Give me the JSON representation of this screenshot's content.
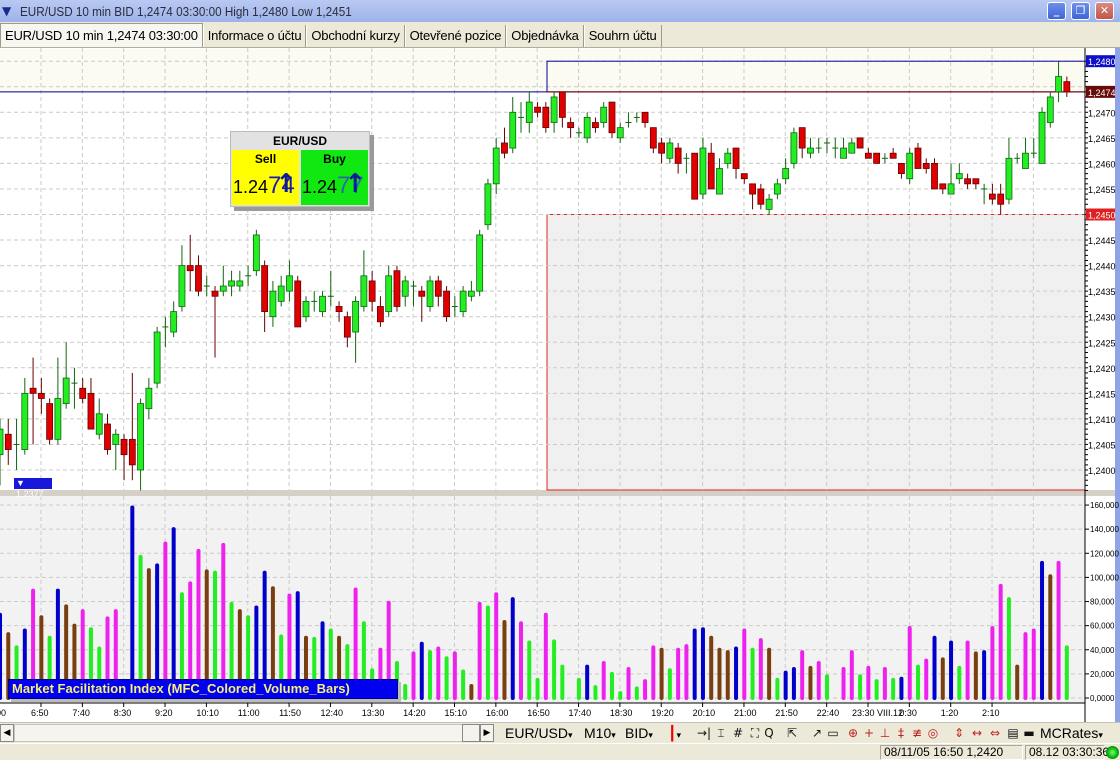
{
  "window": {
    "title": "EUR/USD 10 min BID 1,2474 03:30:00 High 1,2480 Low 1,2451",
    "minimize": "_",
    "restore": "❐",
    "close": "✕"
  },
  "tabs": [
    {
      "label": "EUR/USD 10 min 1,2474 03:30:00",
      "active": true
    },
    {
      "label": "Informace o účtu"
    },
    {
      "label": "Obchodní kurzy"
    },
    {
      "label": "Otevřené pozice"
    },
    {
      "label": "Objednávka"
    },
    {
      "label": "Souhrn účtu"
    }
  ],
  "widget": {
    "pair": "EUR/USD",
    "sell_label": "Sell",
    "buy_label": "Buy",
    "sell_prefix": "1.24",
    "sell_pips": "74",
    "buy_prefix": "1.24",
    "buy_pips": "77",
    "arrow": "↑"
  },
  "low_marker": "1,2377",
  "indicator_label": "Market Facilitation Index (MFC_Colored_Volume_Bars)",
  "colors": {
    "up": "#22ee22",
    "down": "#e00000",
    "g": "#22ee22",
    "m": "#ee22ee",
    "b": "#0000cc",
    "br": "#7a3f10",
    "high_line": "#0000a0",
    "last_line": "#7a0000",
    "low_line": "#e02020"
  },
  "price_axis": {
    "labels": [
      "1,2400",
      "1,2405",
      "1,2410",
      "1,2415",
      "1,2420",
      "1,2425",
      "1,2430",
      "1,2435",
      "1,2440",
      "1,2445",
      "1,2455",
      "1,2460",
      "1,2465",
      "1,2470"
    ],
    "markers": [
      {
        "label": "1,2480",
        "price": 1.248,
        "color": "#1010c8"
      },
      {
        "label": "1,2474",
        "price": 1.2474,
        "color": "#6b0a0a"
      },
      {
        "label": "1,2450",
        "price": 1.245,
        "color": "#e02020"
      }
    ]
  },
  "volume_axis": {
    "labels": [
      "0,0000",
      "20,000",
      "40,000",
      "60,000",
      "80,000",
      "100,000",
      "120,000",
      "140,000",
      "160,000"
    ]
  },
  "time_axis": {
    "labels": [
      "00",
      "6:50",
      "7:40",
      "8:30",
      "9:20",
      "10:10",
      "11:00",
      "11:50",
      "12:40",
      "13:30",
      "14:20",
      "15:10",
      "16:00",
      "16:50",
      "17:40",
      "18:30",
      "19:20",
      "20:10",
      "21:00",
      "21:50",
      "22:40",
      "23:30 VIII.12",
      "0:30",
      "1:20",
      "2:10"
    ]
  },
  "chart_data": {
    "type": "candlestick",
    "symbol": "EUR/USD",
    "timeframe": "10 min",
    "ylim": [
      1.2396,
      1.2482
    ],
    "ohlc": [
      [
        1.2403,
        1.241,
        1.2397,
        1.2408
      ],
      [
        1.2407,
        1.241,
        1.2401,
        1.2404
      ],
      [
        1.2405,
        1.241,
        1.24,
        1.2405
      ],
      [
        1.2404,
        1.2418,
        1.2403,
        1.2415
      ],
      [
        1.2416,
        1.2422,
        1.2405,
        1.2415
      ],
      [
        1.2415,
        1.2418,
        1.2411,
        1.2414
      ],
      [
        1.2413,
        1.2414,
        1.2405,
        1.2406
      ],
      [
        1.2406,
        1.2422,
        1.2405,
        1.2414
      ],
      [
        1.2413,
        1.2425,
        1.2412,
        1.2418
      ],
      [
        1.2417,
        1.242,
        1.2412,
        1.2417
      ],
      [
        1.2416,
        1.2418,
        1.2413,
        1.2414
      ],
      [
        1.2415,
        1.2418,
        1.2408,
        1.2408
      ],
      [
        1.2407,
        1.2414,
        1.2406,
        1.2411
      ],
      [
        1.2409,
        1.2411,
        1.2403,
        1.2404
      ],
      [
        1.2405,
        1.2408,
        1.24,
        1.2407
      ],
      [
        1.2406,
        1.2407,
        1.2398,
        1.2403
      ],
      [
        1.2406,
        1.2419,
        1.2398,
        1.2401
      ],
      [
        1.24,
        1.2414,
        1.2396,
        1.2413
      ],
      [
        1.2412,
        1.2418,
        1.241,
        1.2416
      ],
      [
        1.2417,
        1.2428,
        1.2416,
        1.2427
      ],
      [
        1.2428,
        1.243,
        1.2424,
        1.2428
      ],
      [
        1.2427,
        1.2433,
        1.2426,
        1.2431
      ],
      [
        1.2432,
        1.2444,
        1.2431,
        1.244
      ],
      [
        1.244,
        1.2446,
        1.2435,
        1.2439
      ],
      [
        1.244,
        1.2442,
        1.2434,
        1.2435
      ],
      [
        1.2436,
        1.2438,
        1.2434,
        1.2436
      ],
      [
        1.2435,
        1.2436,
        1.2422,
        1.2434
      ],
      [
        1.2435,
        1.244,
        1.2434,
        1.2436
      ],
      [
        1.2436,
        1.2439,
        1.2434,
        1.2437
      ],
      [
        1.2436,
        1.2439,
        1.2435,
        1.2437
      ],
      [
        1.2438,
        1.244,
        1.2436,
        1.2438
      ],
      [
        1.2439,
        1.2447,
        1.2438,
        1.2446
      ],
      [
        1.244,
        1.2441,
        1.2427,
        1.2431
      ],
      [
        1.243,
        1.2437,
        1.2428,
        1.2435
      ],
      [
        1.2433,
        1.2438,
        1.2432,
        1.2436
      ],
      [
        1.2435,
        1.2441,
        1.2433,
        1.2438
      ],
      [
        1.2437,
        1.2438,
        1.2428,
        1.2428
      ],
      [
        1.243,
        1.2434,
        1.2429,
        1.2433
      ],
      [
        1.2433,
        1.2435,
        1.2431,
        1.2433
      ],
      [
        1.2431,
        1.2435,
        1.243,
        1.2434
      ],
      [
        1.2434,
        1.2439,
        1.2432,
        1.2434
      ],
      [
        1.2432,
        1.2433,
        1.2429,
        1.2431
      ],
      [
        1.243,
        1.2431,
        1.2424,
        1.2426
      ],
      [
        1.2427,
        1.2434,
        1.2421,
        1.2433
      ],
      [
        1.2432,
        1.2443,
        1.2431,
        1.2438
      ],
      [
        1.2437,
        1.2439,
        1.2431,
        1.2433
      ],
      [
        1.2432,
        1.2434,
        1.2428,
        1.2429
      ],
      [
        1.2431,
        1.244,
        1.243,
        1.2438
      ],
      [
        1.2439,
        1.244,
        1.2431,
        1.2432
      ],
      [
        1.2434,
        1.2438,
        1.2432,
        1.2437
      ],
      [
        1.2436,
        1.2437,
        1.2432,
        1.2436
      ],
      [
        1.2435,
        1.2436,
        1.2429,
        1.2434
      ],
      [
        1.2432,
        1.2438,
        1.2431,
        1.2437
      ],
      [
        1.2437,
        1.2438,
        1.2432,
        1.2434
      ],
      [
        1.2435,
        1.2436,
        1.2429,
        1.243
      ],
      [
        1.2432,
        1.2434,
        1.243,
        1.2432
      ],
      [
        1.2431,
        1.2436,
        1.243,
        1.2435
      ],
      [
        1.2434,
        1.2437,
        1.2433,
        1.2435
      ],
      [
        1.2435,
        1.2447,
        1.2434,
        1.2446
      ],
      [
        1.2448,
        1.2457,
        1.2447,
        1.2456
      ],
      [
        1.2456,
        1.2465,
        1.2454,
        1.2463
      ],
      [
        1.2464,
        1.2467,
        1.2461,
        1.2462
      ],
      [
        1.2463,
        1.2473,
        1.2462,
        1.247
      ],
      [
        1.2469,
        1.2472,
        1.2466,
        1.2469
      ],
      [
        1.2468,
        1.2474,
        1.2466,
        1.2472
      ],
      [
        1.2471,
        1.2472,
        1.2469,
        1.247
      ],
      [
        1.2471,
        1.2472,
        1.2466,
        1.2467
      ],
      [
        1.2468,
        1.2474,
        1.2466,
        1.2473
      ],
      [
        1.2474,
        1.2474,
        1.2467,
        1.2469
      ],
      [
        1.2468,
        1.2469,
        1.2465,
        1.2467
      ],
      [
        1.2466,
        1.2467,
        1.2465,
        1.2466
      ],
      [
        1.2465,
        1.247,
        1.2464,
        1.2469
      ],
      [
        1.2468,
        1.2469,
        1.2466,
        1.2467
      ],
      [
        1.2468,
        1.2472,
        1.2467,
        1.2471
      ],
      [
        1.2472,
        1.2472,
        1.2465,
        1.2466
      ],
      [
        1.2465,
        1.2468,
        1.2464,
        1.2467
      ],
      [
        1.2468,
        1.247,
        1.2467,
        1.2468
      ],
      [
        1.2469,
        1.247,
        1.2468,
        1.2469
      ],
      [
        1.247,
        1.247,
        1.2467,
        1.2468
      ],
      [
        1.2467,
        1.2467,
        1.2462,
        1.2463
      ],
      [
        1.2464,
        1.2465,
        1.246,
        1.2462
      ],
      [
        1.2461,
        1.2465,
        1.246,
        1.2464
      ],
      [
        1.2463,
        1.2464,
        1.2458,
        1.246
      ],
      [
        1.2461,
        1.2462,
        1.2458,
        1.2461
      ],
      [
        1.2462,
        1.2462,
        1.2453,
        1.2453
      ],
      [
        1.2454,
        1.2465,
        1.2453,
        1.2463
      ],
      [
        1.2462,
        1.2464,
        1.2455,
        1.2455
      ],
      [
        1.2454,
        1.2461,
        1.2454,
        1.2459
      ],
      [
        1.246,
        1.2463,
        1.2459,
        1.2462
      ],
      [
        1.2463,
        1.2463,
        1.2457,
        1.2459
      ],
      [
        1.2458,
        1.2458,
        1.2456,
        1.2457
      ],
      [
        1.2456,
        1.2456,
        1.2451,
        1.2454
      ],
      [
        1.2455,
        1.2456,
        1.2451,
        1.2452
      ],
      [
        1.2451,
        1.2454,
        1.245,
        1.2453
      ],
      [
        1.2454,
        1.2457,
        1.2453,
        1.2456
      ],
      [
        1.2457,
        1.2461,
        1.2456,
        1.2459
      ],
      [
        1.246,
        1.2467,
        1.2459,
        1.2466
      ],
      [
        1.2467,
        1.2467,
        1.2461,
        1.2463
      ],
      [
        1.2462,
        1.2465,
        1.2461,
        1.2463
      ],
      [
        1.2463,
        1.2465,
        1.2462,
        1.2463
      ],
      [
        1.2464,
        1.2465,
        1.2462,
        1.2464
      ],
      [
        1.2463,
        1.2465,
        1.2461,
        1.2463
      ],
      [
        1.2461,
        1.2465,
        1.2461,
        1.2463
      ],
      [
        1.2462,
        1.2465,
        1.2462,
        1.2464
      ],
      [
        1.2465,
        1.2465,
        1.2463,
        1.2463
      ],
      [
        1.2462,
        1.2463,
        1.2461,
        1.2461
      ],
      [
        1.2462,
        1.2462,
        1.246,
        1.246
      ],
      [
        1.2461,
        1.2462,
        1.246,
        1.2461
      ],
      [
        1.2462,
        1.2463,
        1.2461,
        1.2461
      ],
      [
        1.246,
        1.246,
        1.2457,
        1.2458
      ],
      [
        1.2457,
        1.2463,
        1.2456,
        1.2462
      ],
      [
        1.2463,
        1.2464,
        1.2459,
        1.2459
      ],
      [
        1.246,
        1.2461,
        1.2458,
        1.2459
      ],
      [
        1.246,
        1.2461,
        1.2455,
        1.2455
      ],
      [
        1.2456,
        1.2456,
        1.2454,
        1.2455
      ],
      [
        1.2454,
        1.246,
        1.2454,
        1.2456
      ],
      [
        1.2457,
        1.246,
        1.2456,
        1.2458
      ],
      [
        1.2457,
        1.2458,
        1.2455,
        1.2456
      ],
      [
        1.2457,
        1.2457,
        1.2455,
        1.2456
      ],
      [
        1.2455,
        1.2456,
        1.2452,
        1.2455
      ],
      [
        1.2454,
        1.2456,
        1.2452,
        1.2453
      ],
      [
        1.2454,
        1.2456,
        1.245,
        1.2452
      ],
      [
        1.2453,
        1.2465,
        1.2452,
        1.2461
      ],
      [
        1.2461,
        1.2462,
        1.246,
        1.2461
      ],
      [
        1.2459,
        1.2465,
        1.2459,
        1.2462
      ],
      [
        1.2462,
        1.2465,
        1.2461,
        1.2462
      ],
      [
        1.246,
        1.2471,
        1.246,
        1.247
      ],
      [
        1.2468,
        1.2474,
        1.2467,
        1.2473
      ],
      [
        1.2474,
        1.248,
        1.2472,
        1.2477
      ],
      [
        1.2476,
        1.2477,
        1.2473,
        1.2474
      ]
    ],
    "volume_thousands": [
      69,
      53,
      42,
      56,
      89,
      67,
      50,
      89,
      76,
      60,
      72,
      57,
      41,
      66,
      72,
      5,
      158,
      117,
      106,
      110,
      128,
      140,
      86,
      95,
      122,
      105,
      104,
      127,
      78,
      72,
      67,
      75,
      104,
      91,
      51,
      85,
      87,
      50,
      49,
      62,
      56,
      50,
      43,
      90,
      62,
      23,
      40,
      79,
      29,
      10,
      37,
      45,
      38,
      41,
      33,
      37,
      22,
      10,
      78,
      75,
      86,
      63,
      82,
      62,
      46,
      15,
      69,
      47,
      26,
      0,
      15,
      26,
      9,
      29,
      20,
      4,
      24,
      8,
      14,
      42,
      40,
      23,
      40,
      43,
      56,
      57,
      50,
      40,
      38,
      41,
      56,
      40,
      48,
      40,
      15,
      21,
      24,
      38,
      25,
      29,
      18,
      0,
      24,
      38,
      18,
      25,
      14,
      24,
      15,
      16,
      58,
      26,
      31,
      50,
      32,
      46,
      25,
      46,
      37,
      38,
      58,
      93,
      82,
      26,
      53,
      56,
      112,
      101,
      112,
      42
    ],
    "volume_colors": [
      "b",
      "br",
      "g",
      "b",
      "m",
      "br",
      "g",
      "b",
      "br",
      "br",
      "m",
      "g",
      "g",
      "m",
      "m",
      "g",
      "b",
      "g",
      "br",
      "b",
      "m",
      "b",
      "g",
      "m",
      "m",
      "br",
      "g",
      "m",
      "g",
      "br",
      "g",
      "b",
      "b",
      "br",
      "g",
      "m",
      "b",
      "br",
      "g",
      "b",
      "g",
      "br",
      "g",
      "m",
      "g",
      "g",
      "m",
      "m",
      "g",
      "g",
      "m",
      "b",
      "g",
      "m",
      "g",
      "m",
      "g",
      "br",
      "m",
      "g",
      "m",
      "br",
      "b",
      "m",
      "g",
      "g",
      "m",
      "g",
      "g",
      "g",
      "g",
      "b",
      "g",
      "m",
      "g",
      "g",
      "m",
      "g",
      "m",
      "m",
      "br",
      "g",
      "m",
      "m",
      "b",
      "b",
      "br",
      "br",
      "br",
      "b",
      "m",
      "g",
      "m",
      "br",
      "g",
      "b",
      "b",
      "m",
      "br",
      "m",
      "g",
      "g",
      "m",
      "m",
      "g",
      "m",
      "g",
      "m",
      "g",
      "b",
      "m",
      "g",
      "m",
      "b",
      "br",
      "b",
      "g",
      "m",
      "br",
      "b",
      "m",
      "m",
      "g",
      "br",
      "m",
      "m",
      "b",
      "br",
      "m",
      "g"
    ],
    "volume_ylim": [
      0,
      160000
    ],
    "levels": {
      "high": 1.248,
      "last": 1.2474,
      "low": 1.245
    }
  },
  "toolbar": {
    "symbol": "EUR/USD",
    "period": "M10",
    "side": "BID",
    "source": "MCRates",
    "dropdown": "▾",
    "icons": [
      "→|",
      "⌶",
      "#",
      "⛶",
      "Q",
      "⇱",
      "↗",
      "▭",
      "⊕",
      "+",
      "⊥",
      "‡",
      "≢",
      "◎",
      "⇕",
      "↔",
      "⇔",
      "▤",
      "▬"
    ]
  },
  "status": {
    "cursor": "08/11/05 16:50  1,2420",
    "clock": "08.12 03:30:36"
  }
}
